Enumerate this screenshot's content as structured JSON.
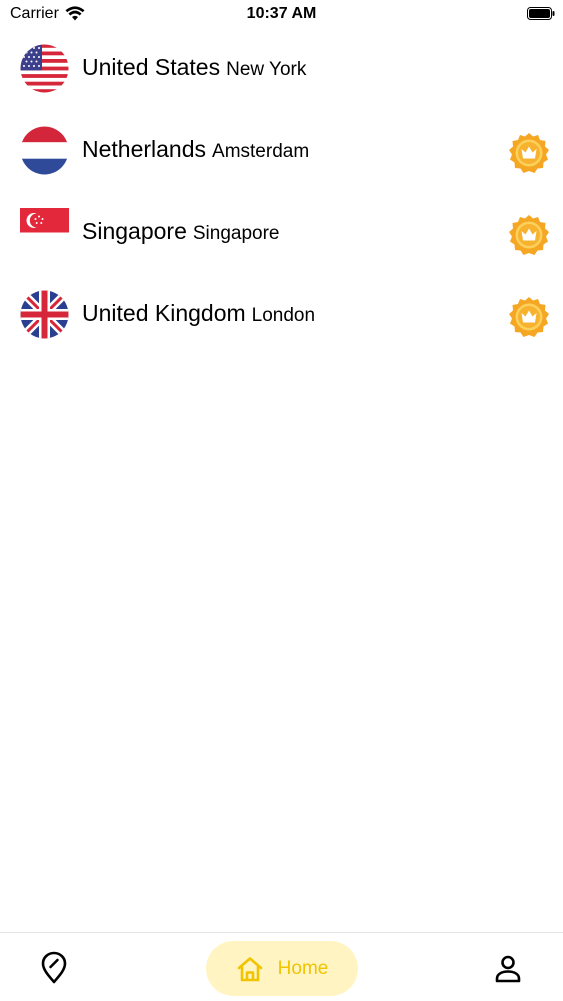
{
  "status_bar": {
    "carrier": "Carrier",
    "time": "10:37 AM"
  },
  "servers": [
    {
      "country": "United States",
      "city": "New York",
      "flag": "us-flag-icon",
      "premium": false
    },
    {
      "country": "Netherlands",
      "city": "Amsterdam",
      "flag": "nl-flag-icon",
      "premium": true
    },
    {
      "country": "Singapore",
      "city": "Singapore",
      "flag": "sg-flag-icon",
      "premium": true
    },
    {
      "country": "United Kingdom",
      "city": "London",
      "flag": "uk-flag-icon",
      "premium": true
    }
  ],
  "tab_bar": {
    "location_icon": "location-pin-icon",
    "home_label": "Home",
    "home_icon": "home-icon",
    "profile_icon": "profile-icon",
    "active_color": "#f0c400",
    "active_bg": "#fff4c2"
  },
  "premium_icon": "crown-icon",
  "colors": {
    "premium_gold": "#f5a623"
  }
}
